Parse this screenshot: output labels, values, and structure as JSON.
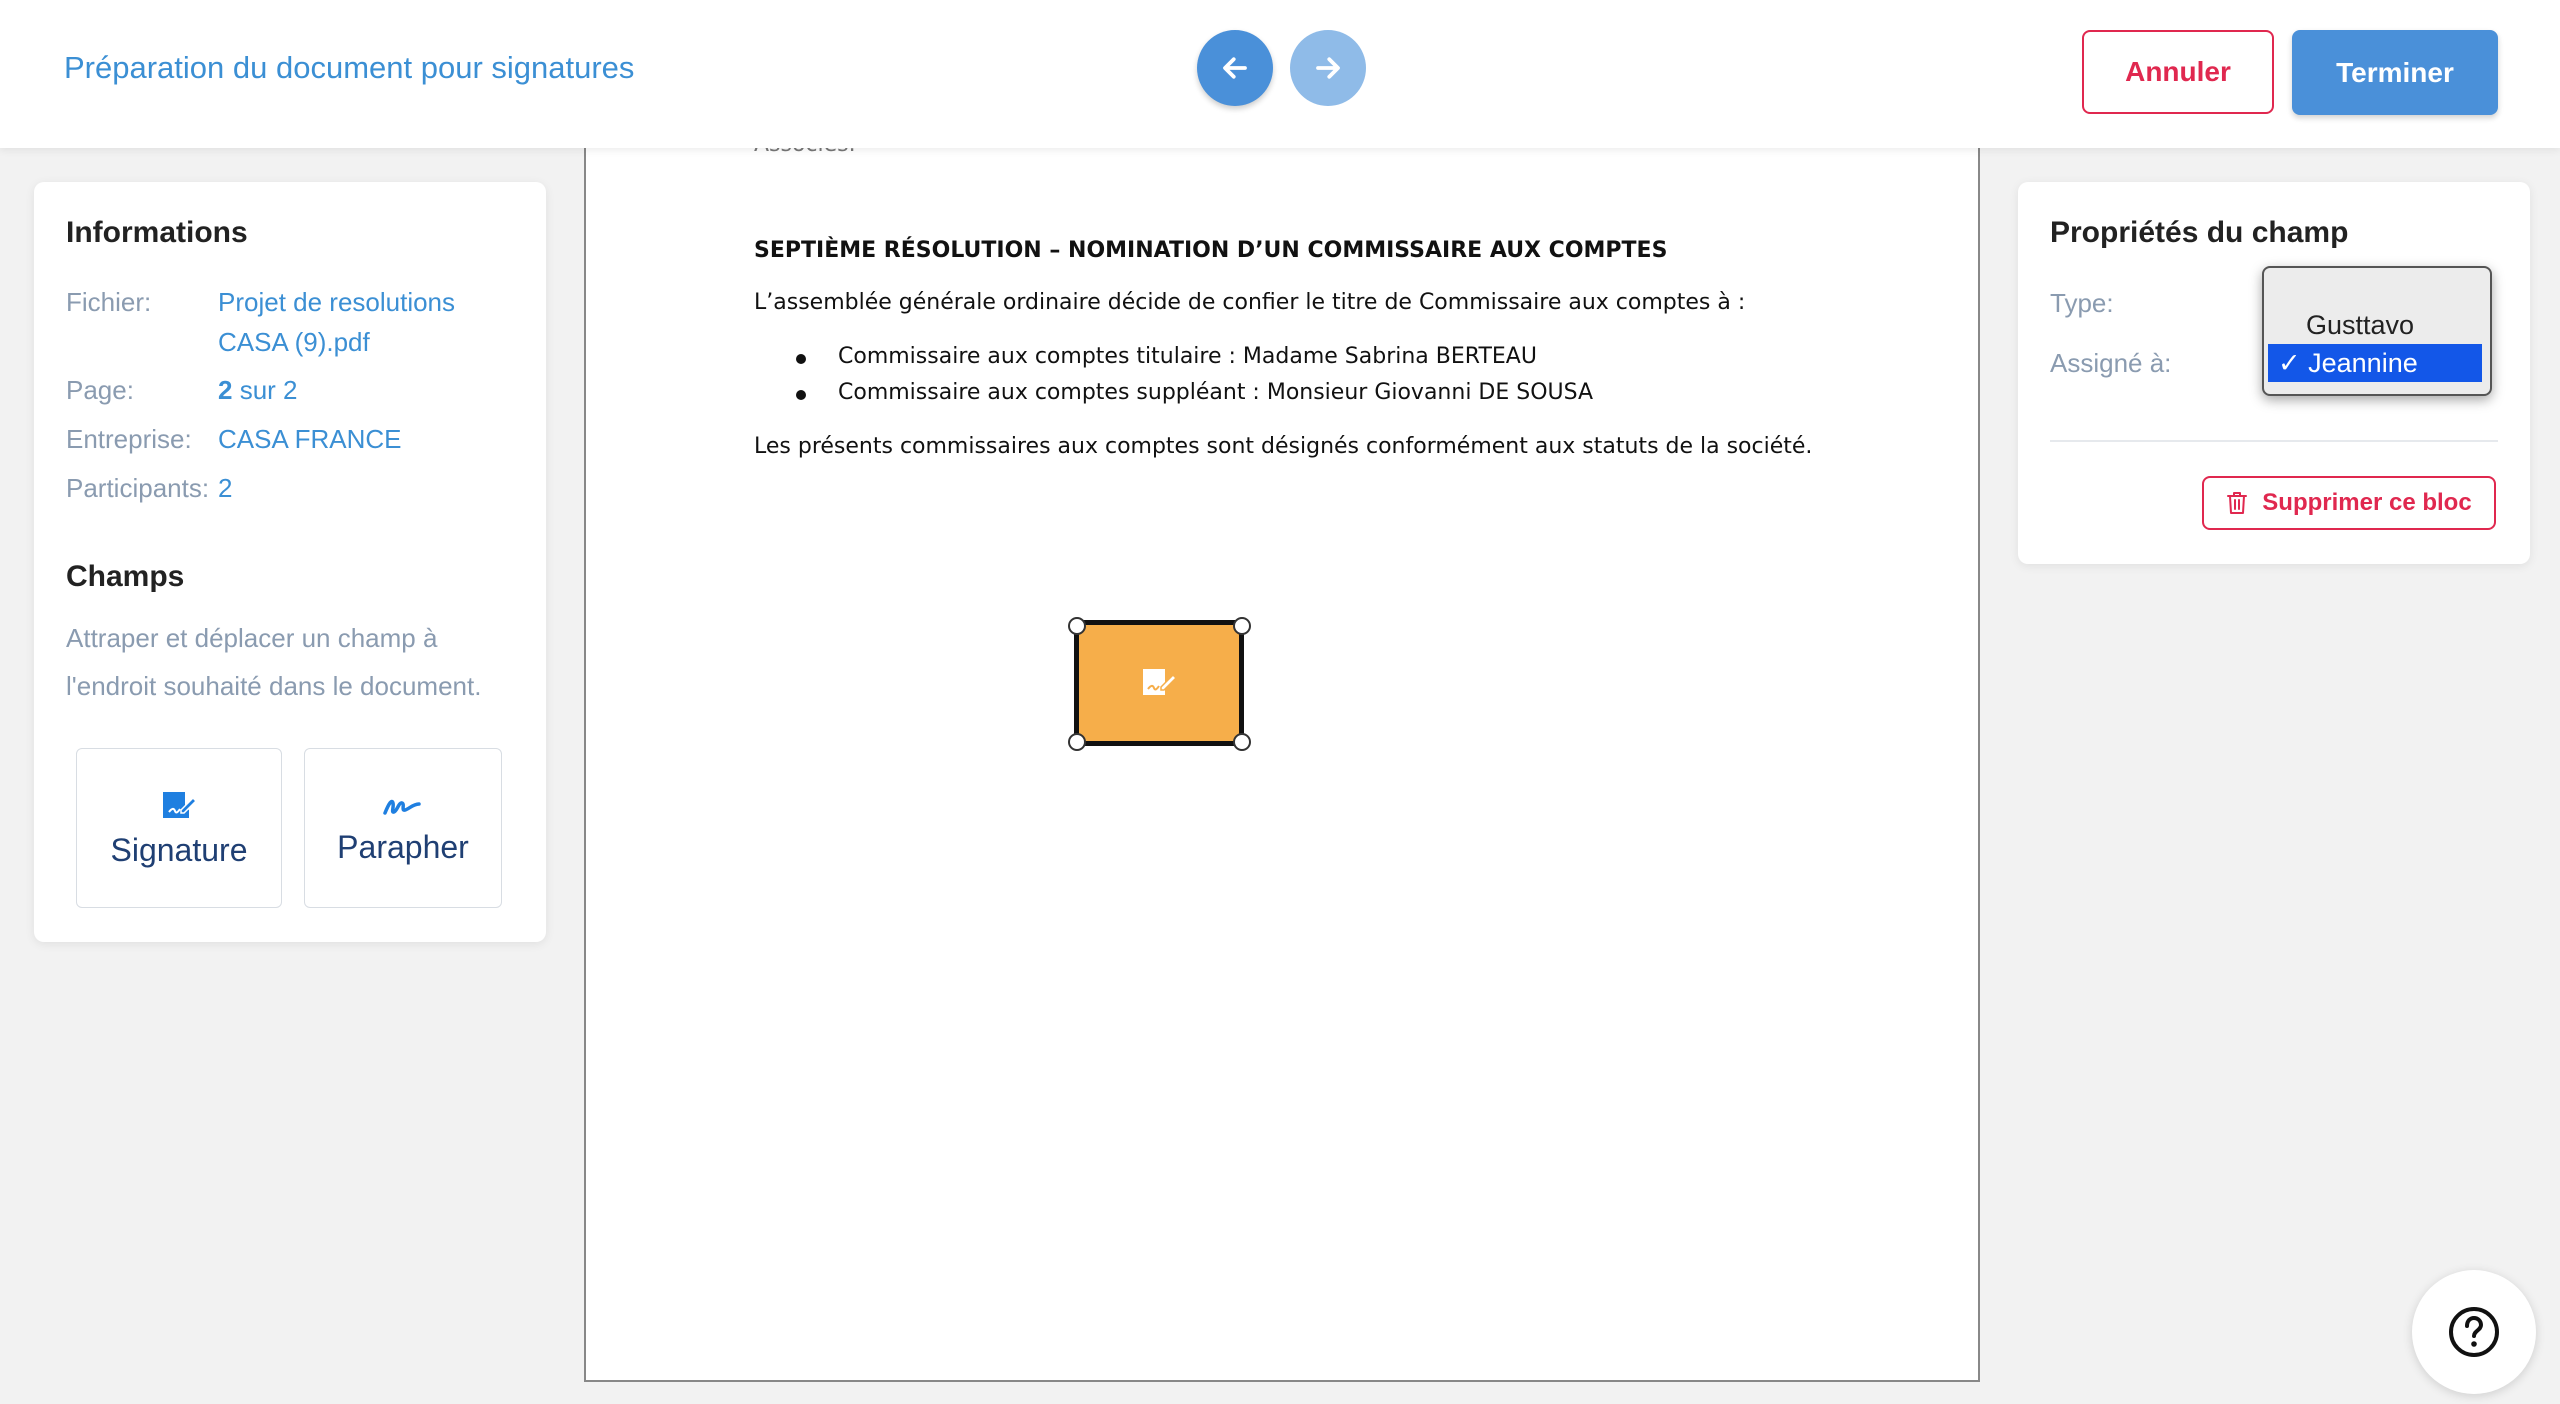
{
  "header": {
    "title": "Préparation du document pour signatures",
    "prev_icon": "arrow-left-icon",
    "next_icon": "arrow-right-icon",
    "cancel_label": "Annuler",
    "finish_label": "Terminer"
  },
  "info": {
    "heading": "Informations",
    "file_label": "Fichier:",
    "file_value_line1": "Projet de resolutions",
    "file_value_line2": "CASA (9).pdf",
    "page_label": "Page:",
    "page_current": "2",
    "page_rest": "sur 2",
    "company_label": "Entreprise:",
    "company_value": "CASA FRANCE",
    "participants_label": "Participants:",
    "participants_value": "2"
  },
  "fields": {
    "heading": "Champs",
    "hint": "Attraper et déplacer un champ à l'endroit souhaité dans le document.",
    "signature_label": "Signature",
    "initial_label": "Parapher"
  },
  "document": {
    "cut_text": "Associés.",
    "heading": "SEPTIÈME RÉSOLUTION – NOMINATION D’UN COMMISSAIRE AUX COMPTES",
    "intro": "L’assemblée générale ordinaire décide de confier le titre de Commissaire aux comptes à :",
    "bullets": [
      "Commissaire aux comptes titulaire : Madame Sabrina BERTEAU",
      "Commissaire aux comptes suppléant : Monsieur Giovanni DE SOUSA"
    ],
    "closing": "Les présents commissaires aux comptes sont désignés conformément aux statuts de la société."
  },
  "properties": {
    "heading": "Propriétés du champ",
    "type_label": "Type:",
    "assigned_label": "Assigné à:",
    "options": [
      "Gusttavo",
      "Jeannine"
    ],
    "selected_option": "✓ Jeannine",
    "delete_label": "Supprimer ce bloc"
  },
  "colors": {
    "accent": "#4a90d9",
    "danger": "#e0284f",
    "field": "#f6ae4a",
    "selection": "#1357e8"
  }
}
